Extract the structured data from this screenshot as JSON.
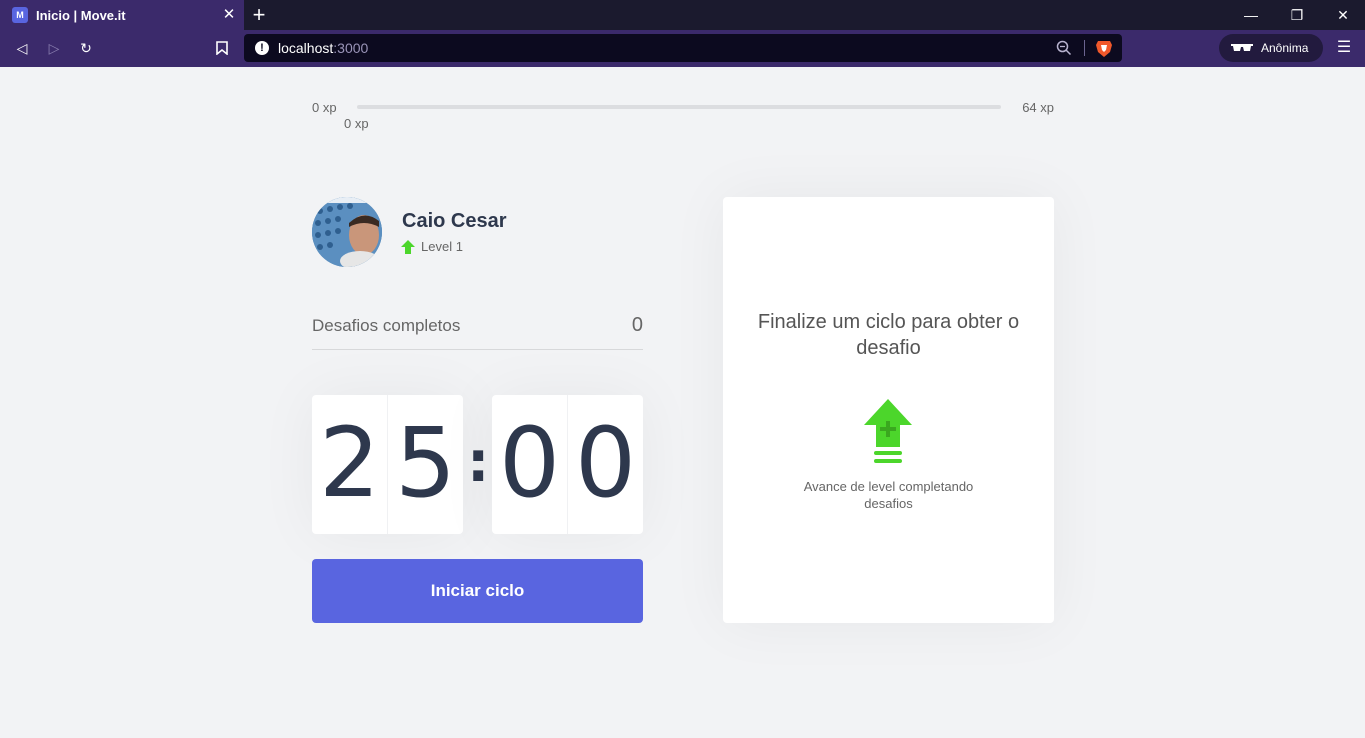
{
  "browser": {
    "tab": {
      "favicon": "M",
      "title": "Inicio | Move.it",
      "close_icon": "close-icon"
    },
    "new_tab": "+",
    "window": {
      "minimize": "—",
      "restore": "❐",
      "close": "✕"
    },
    "nav": {
      "back": "◁",
      "forward": "▷",
      "reload": "↻",
      "bookmark": "bookmark-icon"
    },
    "address": {
      "info": "!",
      "host": "localhost",
      "port": ":3000"
    },
    "private_label": "Anônima",
    "menu": "☰"
  },
  "xp": {
    "start_label": "0 xp",
    "end_label": "64 xp",
    "current_label": "0 xp",
    "progress_fraction": 0,
    "fill_color": "#4cd62b"
  },
  "profile": {
    "name": "Caio Cesar",
    "level_label": "Level 1",
    "level_icon": "level-up-arrow-icon"
  },
  "challenges": {
    "label": "Desafios completos",
    "value": "0"
  },
  "countdown": {
    "minute_left": "2",
    "minute_right": "5",
    "separator": ":",
    "second_left": "0",
    "second_right": "0"
  },
  "start_button": {
    "label": "Iniciar ciclo",
    "color": "#5965e0"
  },
  "challenge_card": {
    "title": "Finalize um ciclo para obter o desafio",
    "icon": "level-up-icon",
    "text": "Avance de level completando desafios",
    "accent": "#4cd62b"
  }
}
